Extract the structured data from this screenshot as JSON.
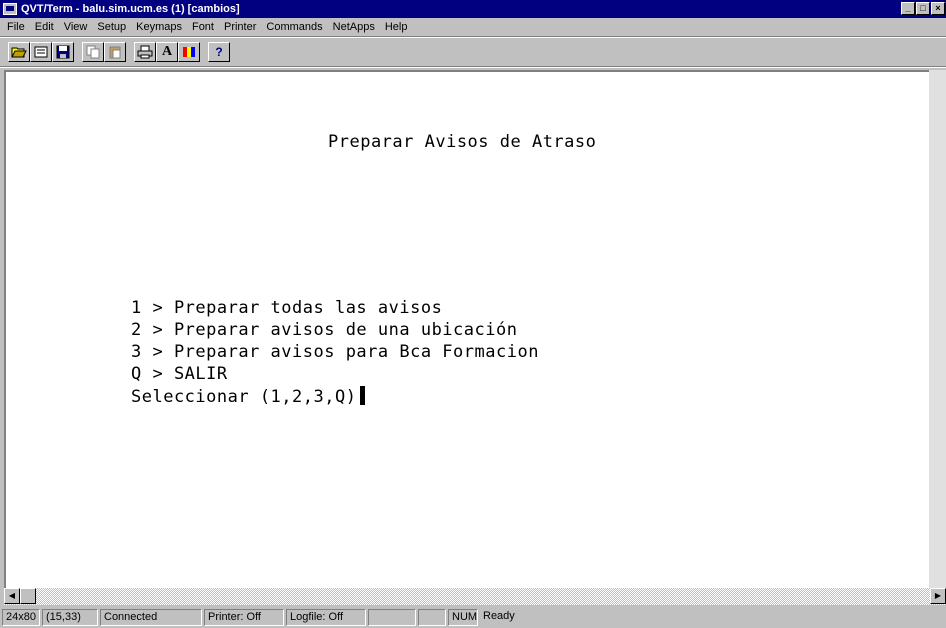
{
  "window": {
    "title": "QVT/Term - balu.sim.ucm.es (1) [cambios]",
    "buttons": {
      "minimize": "_",
      "maximize": "□",
      "close": "×"
    }
  },
  "menu": {
    "items": [
      {
        "label": "File"
      },
      {
        "label": "Edit"
      },
      {
        "label": "View"
      },
      {
        "label": "Setup"
      },
      {
        "label": "Keymaps"
      },
      {
        "label": "Font"
      },
      {
        "label": "Printer"
      },
      {
        "label": "Commands"
      },
      {
        "label": "NetApps"
      },
      {
        "label": "Help"
      }
    ]
  },
  "toolbar": {
    "icons": [
      "open-folder-icon",
      "session-icon",
      "save-icon",
      "copy-icon",
      "paste-icon",
      "print-icon",
      "font-icon",
      "colors-icon",
      "help-icon"
    ],
    "font_glyph": "A",
    "help_glyph": "?"
  },
  "terminal": {
    "title": "Preparar Avisos de Atraso",
    "options": [
      "1 > Preparar todas las avisos",
      "2 > Preparar avisos de una ubicación",
      "3 > Preparar avisos para Bca Formacion",
      "Q > SALIR"
    ],
    "prompt": "Seleccionar (1,2,3,Q)"
  },
  "status": {
    "size": "24x80",
    "cursor_pos": "(15,33)",
    "connection": "Connected",
    "printer": "Printer: Off",
    "logfile": "Logfile: Off",
    "empty1": "",
    "empty2": "",
    "num": "NUM",
    "ready": "Ready"
  },
  "colors": {
    "titlebar": "#000080",
    "chrome": "#c0c0c0",
    "terminal_bg": "#ffffff"
  }
}
